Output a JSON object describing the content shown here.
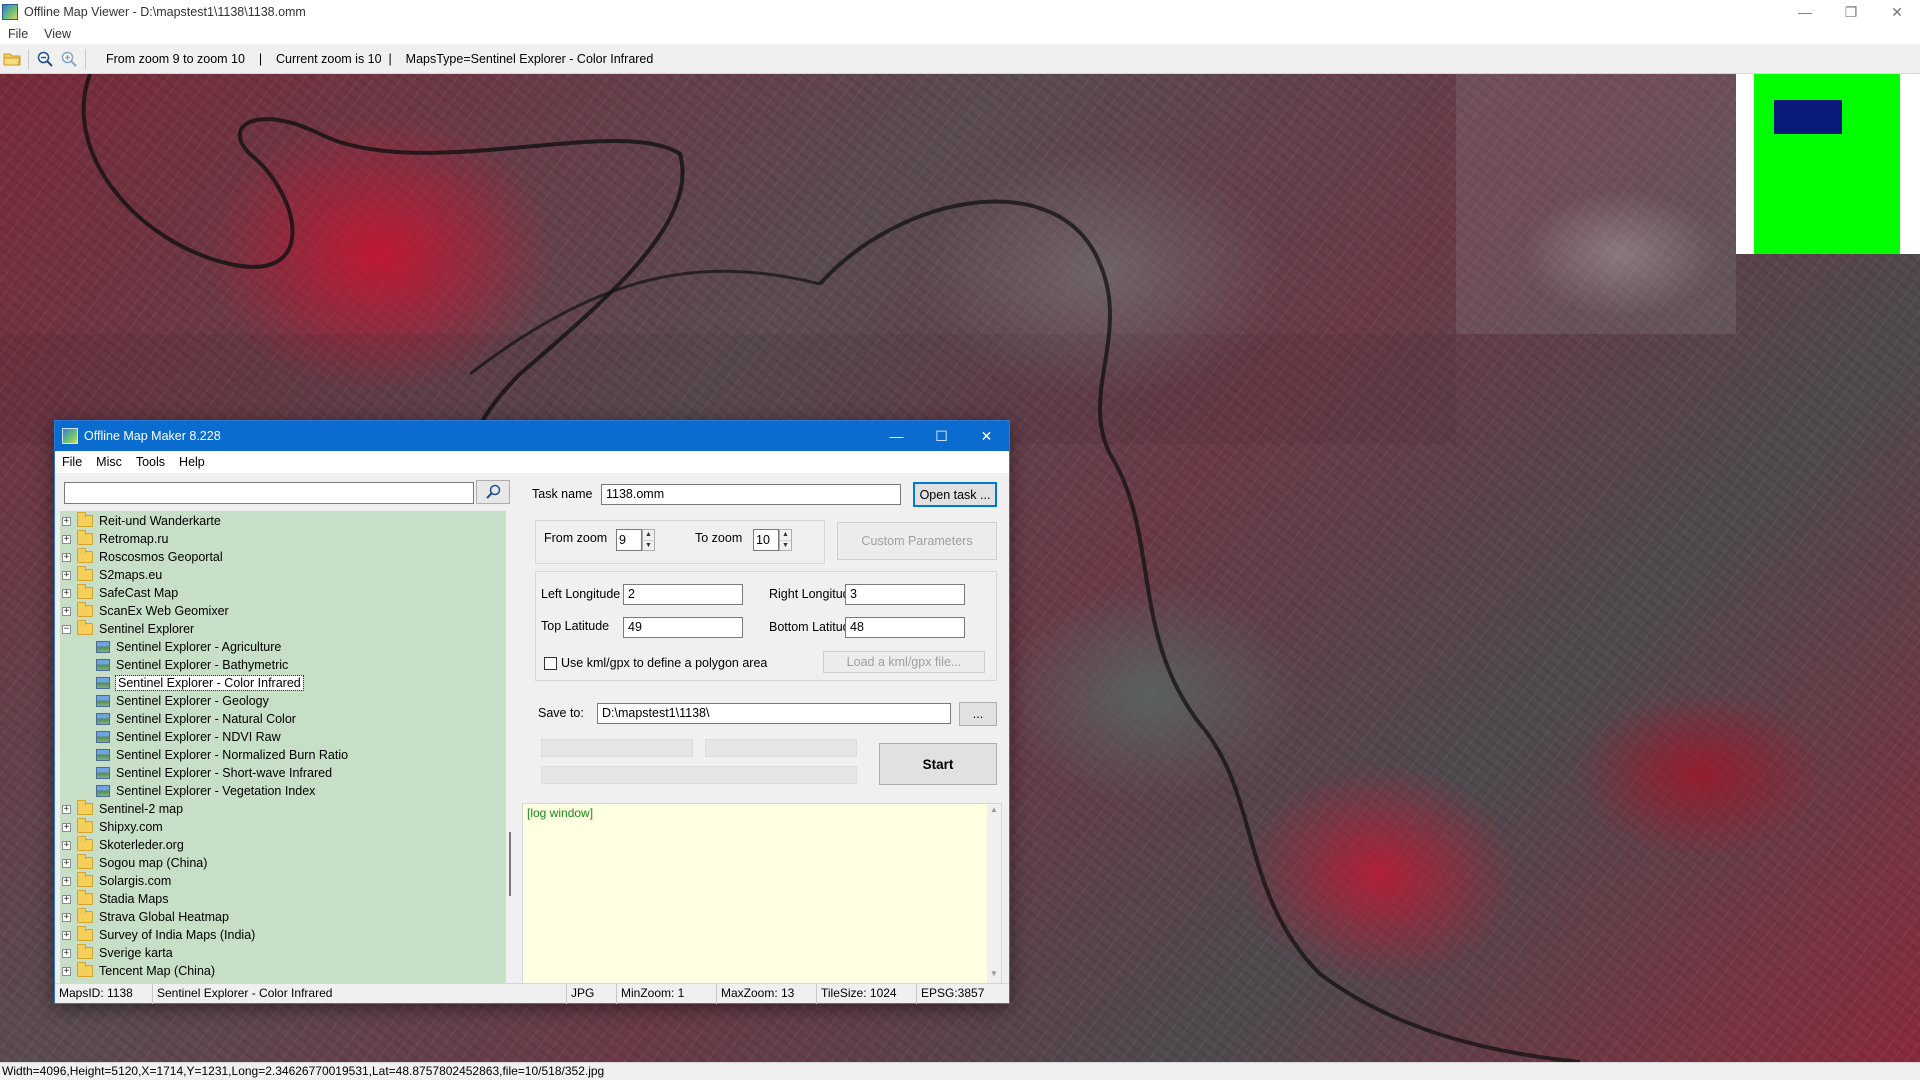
{
  "viewer": {
    "title": "Offline Map Viewer - D:\\mapstest1\\1138\\1138.omm",
    "controls": {
      "minimize": "—",
      "restore": "❐",
      "close": "✕"
    },
    "menu": [
      "File",
      "View"
    ],
    "toolbar_status": "From zoom 9 to zoom 10    |    Current zoom is 10  |    MapsType=Sentinel Explorer - Color Infrared",
    "status_bar": "Width=4096,Height=5120,X=1714,Y=1231,Long=2.34626770019531,Lat=48.8757802452863,file=10/518/352.jpg",
    "minimap_colors": {
      "background": "#00ff00",
      "viewport": "#0a1a7a"
    }
  },
  "dialog": {
    "title": "Offline Map Maker 8.228",
    "controls": {
      "minimize": "—",
      "maximize": "☐",
      "close": "✕"
    },
    "menu": [
      "File",
      "Misc",
      "Tools",
      "Help"
    ],
    "search": {
      "value": "",
      "placeholder": ""
    },
    "tree": [
      {
        "label": "Reit-und Wanderkarte",
        "expander": "+",
        "type": "folder"
      },
      {
        "label": "Retromap.ru",
        "expander": "+",
        "type": "folder"
      },
      {
        "label": "Roscosmos Geoportal",
        "expander": "+",
        "type": "folder"
      },
      {
        "label": "S2maps.eu",
        "expander": "+",
        "type": "folder"
      },
      {
        "label": "SafeCast Map",
        "expander": "+",
        "type": "folder"
      },
      {
        "label": "ScanEx Web Geomixer",
        "expander": "+",
        "type": "folder"
      },
      {
        "label": "Sentinel Explorer",
        "expander": "−",
        "type": "folder-open"
      },
      {
        "label": "Sentinel Explorer - Agriculture",
        "type": "map"
      },
      {
        "label": "Sentinel Explorer - Bathymetric",
        "type": "map"
      },
      {
        "label": "Sentinel Explorer - Color Infrared",
        "type": "map",
        "selected": true
      },
      {
        "label": "Sentinel Explorer - Geology",
        "type": "map"
      },
      {
        "label": "Sentinel Explorer - Natural Color",
        "type": "map"
      },
      {
        "label": "Sentinel Explorer - NDVI Raw",
        "type": "map"
      },
      {
        "label": "Sentinel Explorer - Normalized Burn Ratio",
        "type": "map"
      },
      {
        "label": "Sentinel Explorer - Short-wave Infrared",
        "type": "map"
      },
      {
        "label": "Sentinel Explorer - Vegetation Index",
        "type": "map"
      },
      {
        "label": "Sentinel-2 map",
        "expander": "+",
        "type": "folder"
      },
      {
        "label": "Shipxy.com",
        "expander": "+",
        "type": "folder"
      },
      {
        "label": "Skoterleder.org",
        "expander": "+",
        "type": "folder"
      },
      {
        "label": "Sogou map (China)",
        "expander": "+",
        "type": "folder"
      },
      {
        "label": "Solargis.com",
        "expander": "+",
        "type": "folder"
      },
      {
        "label": "Stadia Maps",
        "expander": "+",
        "type": "folder"
      },
      {
        "label": "Strava Global Heatmap",
        "expander": "+",
        "type": "folder"
      },
      {
        "label": "Survey of India Maps (India)",
        "expander": "+",
        "type": "folder"
      },
      {
        "label": "Sverige karta",
        "expander": "+",
        "type": "folder"
      },
      {
        "label": "Tencent Map (China)",
        "expander": "+",
        "type": "folder"
      }
    ],
    "task": {
      "task_name_label": "Task name",
      "task_name_value": "1138.omm",
      "open_task_label": "Open task ...",
      "from_zoom_label": "From zoom",
      "from_zoom_value": "9",
      "to_zoom_label": "To zoom",
      "to_zoom_value": "10",
      "custom_params_label": "Custom Parameters",
      "left_lon_label": "Left Longitude",
      "left_lon_value": "2",
      "right_lon_label": "Right Longitude",
      "right_lon_value": "3",
      "top_lat_label": "Top Latitude",
      "top_lat_value": "49",
      "bottom_lat_label": "Bottom Latitude",
      "bottom_lat_value": "48",
      "kml_checkbox_label": "Use kml/gpx to define a polygon area",
      "load_kml_label": "Load a kml/gpx file...",
      "save_to_label": "Save to:",
      "save_to_value": "D:\\mapstest1\\1138\\",
      "browse_label": "...",
      "start_label": "Start",
      "log_text": "[log window]"
    },
    "status": {
      "maps_id": "MapsID: 1138",
      "maps_name": "Sentinel Explorer - Color Infrared",
      "format": "JPG",
      "min_zoom": "MinZoom: 1",
      "max_zoom": "MaxZoom: 13",
      "tile_size": "TileSize: 1024",
      "epsg": "EPSG:3857"
    }
  }
}
